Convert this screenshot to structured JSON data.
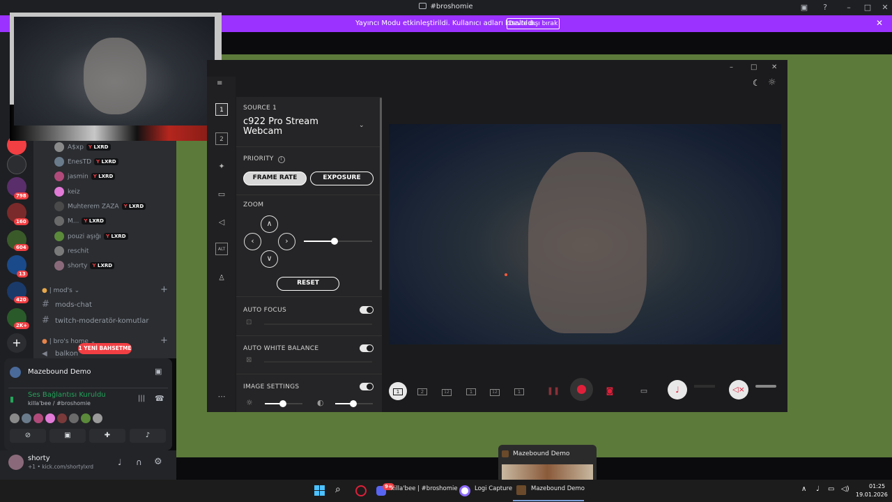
{
  "window": {
    "title": "#broshomie"
  },
  "streamer_banner": {
    "message": "Yayıncı Modu etkinleştirildi. Kullanıcı adları kısaltıldı.",
    "disable_button": "Devre dışı bırak"
  },
  "server_rail": {
    "badges": [
      "798",
      "160",
      "604",
      "13",
      "420",
      "2K+"
    ]
  },
  "members": [
    {
      "name": "A$xp",
      "tag": "LXRD",
      "color": "#8a8a8a"
    },
    {
      "name": "EnesTD",
      "tag": "LXRD",
      "color": "#6a7b8c"
    },
    {
      "name": "jasmin",
      "tag": "LXRD",
      "color": "#b04a7a"
    },
    {
      "name": "keiz",
      "tag": "",
      "color": "#e27ad8"
    },
    {
      "name": "Muhterem ZAZA",
      "tag": "LXRD",
      "color": "#4a4a4a"
    },
    {
      "name": "M...",
      "tag": "LXRD",
      "color": "#6a6a6a"
    },
    {
      "name": "pouzi aşığı",
      "tag": "LXRD",
      "color": "#5a8a3a"
    },
    {
      "name": "reschit",
      "tag": "",
      "color": "#7a7a7a"
    },
    {
      "name": "shorty",
      "tag": "LXRD",
      "color": "#8a6a7a"
    }
  ],
  "categories": {
    "mods": "| mod's",
    "bros_home": "| bro's home"
  },
  "channels": {
    "mods_chat": "mods-chat",
    "twitch_mod": "twitch-moderatör-komutlar",
    "balkon": "balkon"
  },
  "new_mention": "1 YENİ BAHSETME",
  "voice": {
    "activity_title": "Mazebound Demo",
    "connection_status": "Ses Bağlantısı Kuruldu",
    "connection_channel": "killa'bee / #broshomie"
  },
  "user": {
    "name": "shorty",
    "status": "+1 • kick.com/shortylxrd"
  },
  "logi": {
    "source_label": "SOURCE 1",
    "source_name": "c922 Pro Stream Webcam",
    "priority_label": "PRIORITY",
    "frame_rate": "FRAME RATE",
    "exposure": "EXPOSURE",
    "zoom_label": "ZOOM",
    "zoom_level": 0.45,
    "reset": "RESET",
    "auto_focus": "AUTO FOCUS",
    "auto_white_balance": "AUTO WHITE BALANCE",
    "image_settings": "IMAGE SETTINGS",
    "sidebar_items": [
      "1",
      "2",
      "ALT"
    ],
    "layout_buttons": [
      "1",
      "2",
      "12",
      "1",
      "12",
      "1"
    ]
  },
  "taskbar": {
    "items": [
      "killa'bee | #broshomie -",
      "Logi Capture",
      "Mazebound Demo"
    ],
    "discord_badge": "9+",
    "time": "01:25",
    "date": "19.01.2026"
  },
  "task_preview": {
    "title": "Mazebound Demo"
  }
}
